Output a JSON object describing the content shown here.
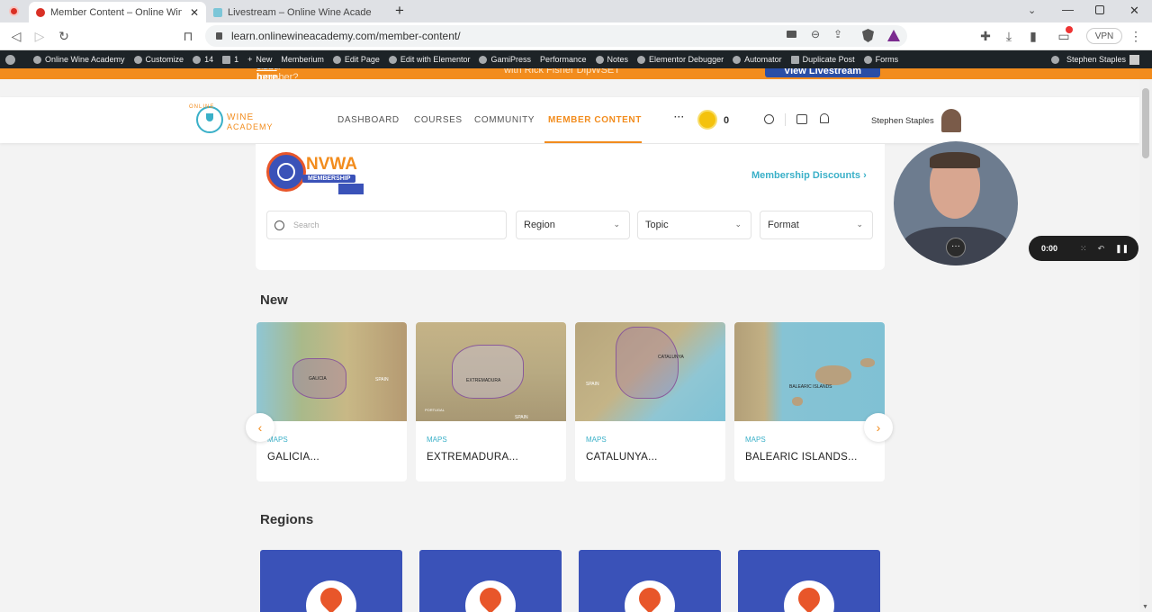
{
  "browser": {
    "tabs": [
      {
        "title": "Member Content – Online Win",
        "active": true
      },
      {
        "title": "Livestream – Online Wine Academy",
        "active": false
      }
    ],
    "new_tab": "+",
    "url": "learn.onlinewineacademy.com/member-content/",
    "vpn": "VPN"
  },
  "adminbar": {
    "items": [
      "Online Wine Academy",
      "Customize",
      "14",
      "1",
      "New",
      "Memberium",
      "Edit Page",
      "Edit with Elementor",
      "GamiPress",
      "Performance",
      "Notes",
      "Elementor Debugger",
      "Automator",
      "Duplicate Post",
      "Forms"
    ],
    "user": "Stephen Staples"
  },
  "banner": {
    "prefix": "Not a member?",
    "join": "Join here.",
    "middle": "with Rick Fisher DipWSET",
    "button": "View Livestream"
  },
  "logo": {
    "top": "ONLINE",
    "wine": "WINE",
    "academy": "ACADEMY"
  },
  "nav": {
    "items": [
      "DASHBOARD",
      "COURSES",
      "COMMUNITY",
      "MEMBER CONTENT"
    ],
    "more": "···",
    "points": "0",
    "user": "Stephen Staples"
  },
  "membership": {
    "badge_title": "NVWA",
    "badge_sub": "MEMBERSHIP",
    "discounts": "Membership Discounts"
  },
  "filters": {
    "search_placeholder": "Search",
    "region": "Region",
    "topic": "Topic",
    "format": "Format"
  },
  "new_section": {
    "title": "New",
    "cards": [
      {
        "tag": "MAPS",
        "title": "GALICIA...",
        "map_labels": [
          "GALICIA",
          "SPAIN"
        ]
      },
      {
        "tag": "MAPS",
        "title": "EXTREMADURA...",
        "map_labels": [
          "EXTREMADURA",
          "PORTUGAL",
          "SPAIN"
        ]
      },
      {
        "tag": "MAPS",
        "title": "CATALUNYA...",
        "map_labels": [
          "CATALUNYA",
          "SPAIN"
        ]
      },
      {
        "tag": "MAPS",
        "title": "BALEARIC ISLANDS...",
        "map_labels": [
          "BALEARIC ISLANDS"
        ]
      }
    ]
  },
  "regions_section": {
    "title": "Regions"
  },
  "recorder": {
    "time": "0:00"
  },
  "colors": {
    "accent": "#f28c1d",
    "teal": "#3ab0c8",
    "region_blue": "#3a52b8",
    "admin_bg": "#1d2327"
  }
}
